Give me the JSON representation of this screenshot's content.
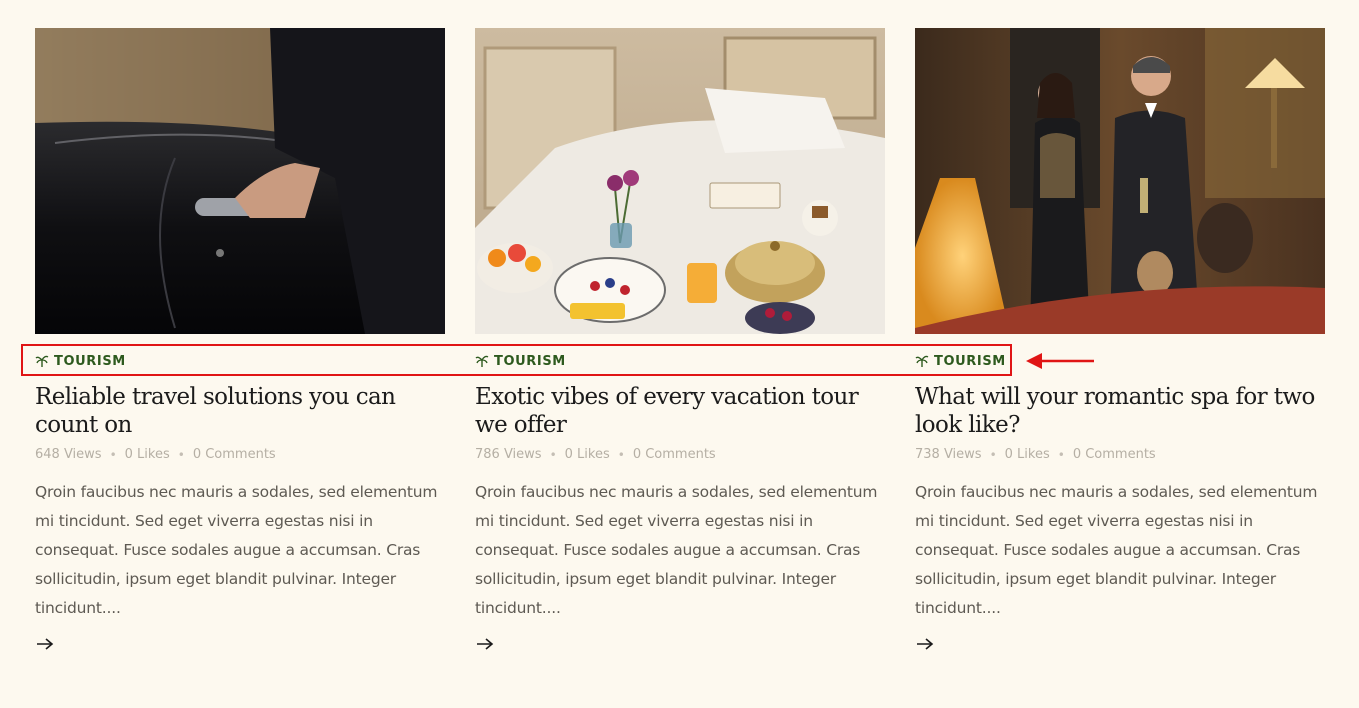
{
  "posts": [
    {
      "image_alt": "Chauffeur opening black car door",
      "category": "TOURISM",
      "title": "Reliable travel solutions you can count on",
      "views": "648 Views",
      "likes": "0 Likes",
      "comments": "0 Comments",
      "excerpt": "Qroin faucibus nec mauris a sodales, sed elementum mi tincidunt. Sed eget viverra egestas nisi in consequat. Fusce sodales augue a accumsan. Cras sollicitudin, ipsum eget blandit pulvinar. Integer tincidunt...."
    },
    {
      "image_alt": "Breakfast served on hotel bed",
      "category": "TOURISM",
      "title": "Exotic vibes of every vacation tour we offer",
      "views": "786 Views",
      "likes": "0 Likes",
      "comments": "0 Comments",
      "excerpt": "Qroin faucibus nec mauris a sodales, sed elementum mi tincidunt. Sed eget viverra egestas nisi in consequat. Fusce sodales augue a accumsan. Cras sollicitudin, ipsum eget blandit pulvinar. Integer tincidunt...."
    },
    {
      "image_alt": "Couple in elegant hotel lounge",
      "category": "TOURISM",
      "title": "What will your romantic spa for two look like?",
      "views": "738 Views",
      "likes": "0 Likes",
      "comments": "0 Comments",
      "excerpt": "Qroin faucibus nec mauris a sodales, sed elementum mi tincidunt. Sed eget viverra egestas nisi in consequat. Fusce sodales augue a accumsan. Cras sollicitudin, ipsum eget blandit pulvinar. Integer tincidunt...."
    }
  ],
  "meta_separator": "•",
  "icons": {
    "category": "palm-tree-icon",
    "read_more": "arrow-right-icon"
  },
  "colors": {
    "background": "#fdf9ef",
    "category": "#2d5a1e",
    "annotation": "#e01515"
  }
}
